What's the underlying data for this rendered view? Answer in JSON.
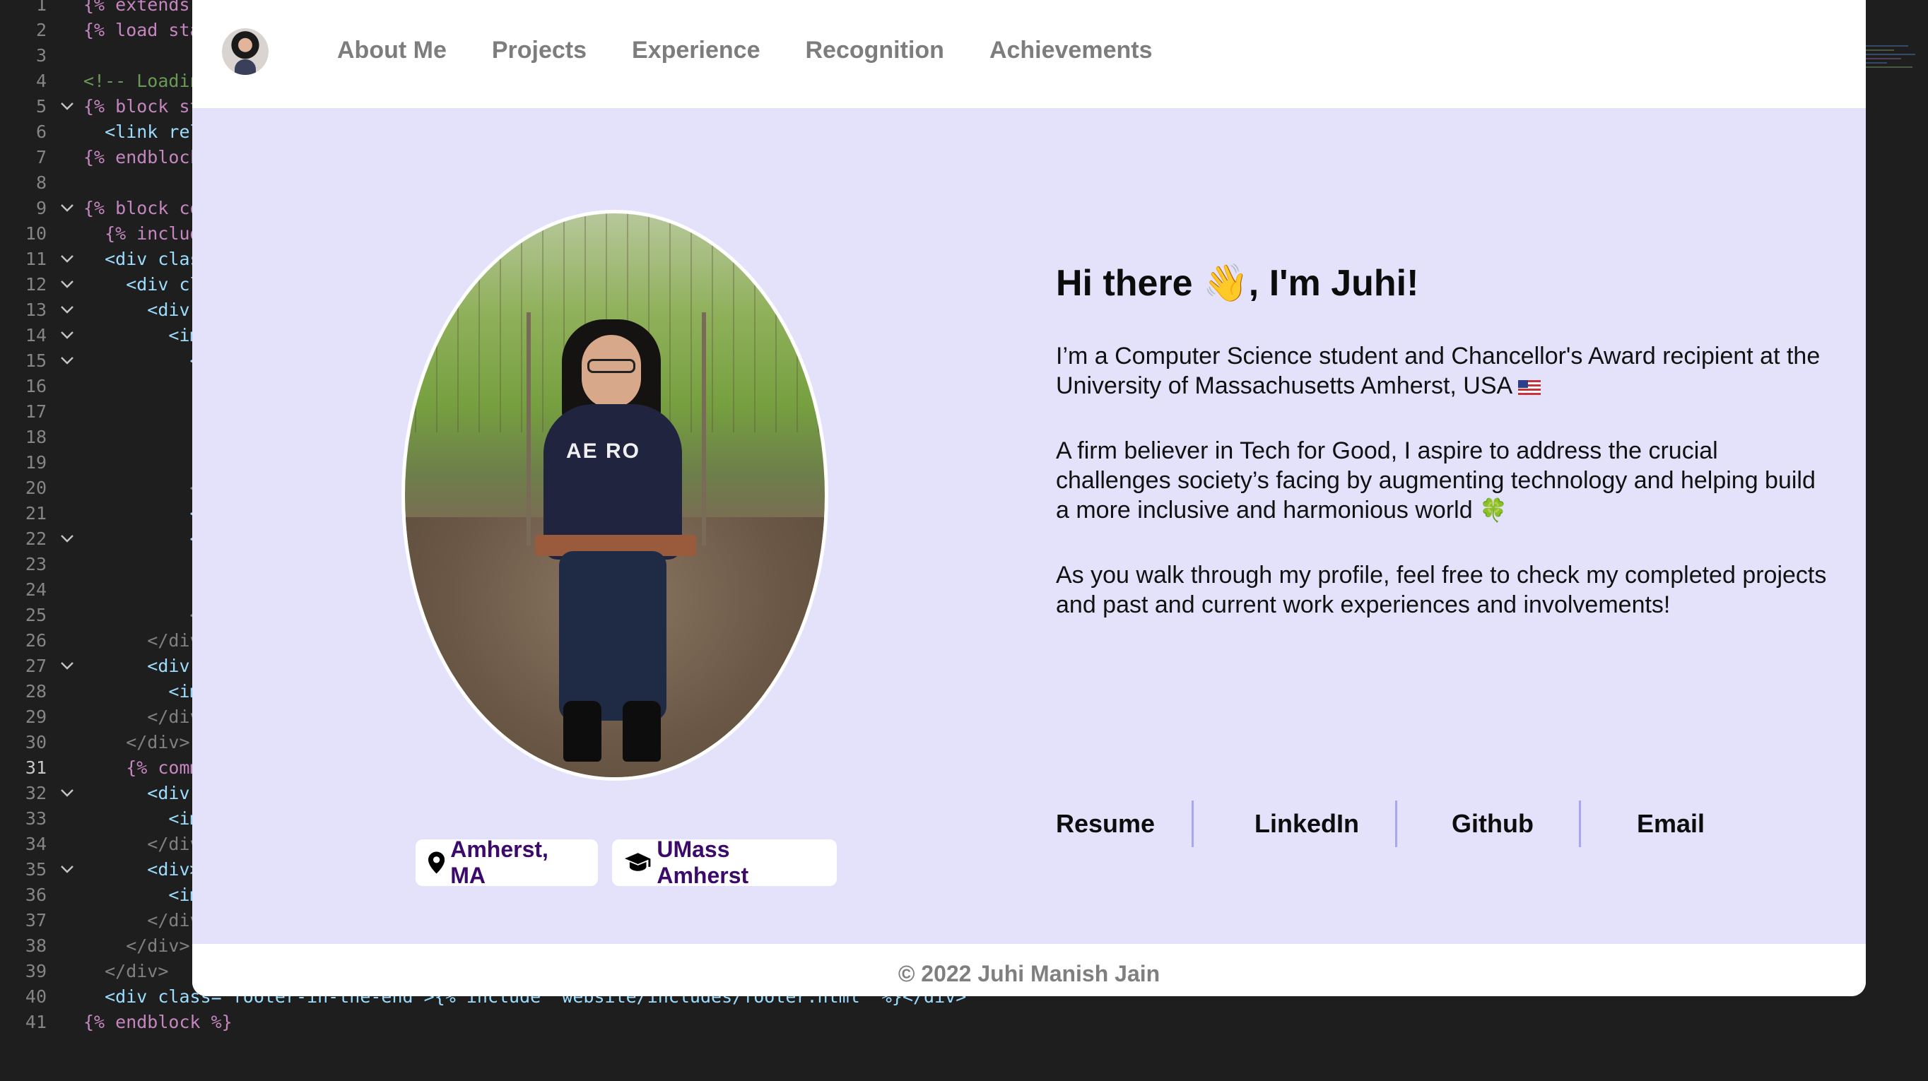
{
  "editor": {
    "lines": [
      {
        "n": "1",
        "text": "{% extends"
      },
      {
        "n": "2",
        "text": "{% load sta"
      },
      {
        "n": "3",
        "text": ""
      },
      {
        "n": "4",
        "text": "<!-- Loadin"
      },
      {
        "n": "5",
        "text": "{% block st"
      },
      {
        "n": "6",
        "text": "  <link rel"
      },
      {
        "n": "7",
        "text": "{% endblock"
      },
      {
        "n": "8",
        "text": ""
      },
      {
        "n": "9",
        "text": "{% block co"
      },
      {
        "n": "10",
        "text": "  {% includ"
      },
      {
        "n": "11",
        "text": "  <div clas"
      },
      {
        "n": "12",
        "text": "    <div cl"
      },
      {
        "n": "13",
        "text": "      <div"
      },
      {
        "n": "14",
        "text": "        <im"
      },
      {
        "n": "15",
        "text": "          <d"
      },
      {
        "n": "16",
        "text": "            <"
      },
      {
        "n": "17",
        "text": "            <"
      },
      {
        "n": "18",
        "text": "            <"
      },
      {
        "n": "19",
        "text": "            <"
      },
      {
        "n": "20",
        "text": "          </c"
      },
      {
        "n": "21",
        "text": "          <p>"
      },
      {
        "n": "22",
        "text": "          <di"
      },
      {
        "n": "23",
        "text": "            <"
      },
      {
        "n": "24",
        "text": "            <"
      },
      {
        "n": "25",
        "text": "          </c"
      },
      {
        "n": "26",
        "text": "      </div"
      },
      {
        "n": "27",
        "text": "      <div"
      },
      {
        "n": "28",
        "text": "        <im"
      },
      {
        "n": "29",
        "text": "      </div"
      },
      {
        "n": "30",
        "text": "    </div>"
      },
      {
        "n": "31",
        "text": "    {% comm"
      },
      {
        "n": "32",
        "text": "      <div"
      },
      {
        "n": "33",
        "text": "        <im"
      },
      {
        "n": "34",
        "text": "      </div"
      },
      {
        "n": "35",
        "text": "      <div>"
      },
      {
        "n": "36",
        "text": "        <im"
      },
      {
        "n": "37",
        "text": "      </div"
      },
      {
        "n": "38",
        "text": "    </div>"
      },
      {
        "n": "39",
        "text": "  </div>"
      },
      {
        "n": "40",
        "text": "  <div class=\"footer-in-the-end\">{% include \"website/includes/footer.html\" %}</div>"
      },
      {
        "n": "41",
        "text": "{% endblock %}"
      }
    ]
  },
  "nav": {
    "links": [
      "About Me",
      "Projects",
      "Experience",
      "Recognition",
      "Achievements"
    ]
  },
  "hero": {
    "greeting": "Hi there 👋, I'm Juhi!",
    "para1": "I’m a Computer Science student and Chancellor's Award recipient at the University of Massachusetts Amherst, USA",
    "para2": "A firm believer in Tech for Good, I aspire to address the crucial challenges society’s facing by augmenting technology and helping build a more inclusive and harmonious world",
    "para2_icon": "🍀",
    "para3": "As you walk through my profile, feel free to check my completed projects and past and current work experiences and involvements!",
    "portrait_shirt_text": "AE RO",
    "tags": {
      "location": "Amherst, MA",
      "school": "UMass Amherst"
    },
    "links": {
      "resume": "Resume",
      "linkedin": "LinkedIn",
      "github": "Github",
      "email": "Email"
    }
  },
  "footer": {
    "text": "© 2022 Juhi Manish Jain"
  },
  "colors": {
    "hero_bg": "#e3e2fa",
    "tag_text": "#3c0a6b",
    "divider": "#a9a6ee",
    "nav_text": "#7d7d7d"
  },
  "icons": {
    "location": "map-marker-icon",
    "school": "graduation-cap-icon",
    "flag": "us-flag-icon"
  }
}
